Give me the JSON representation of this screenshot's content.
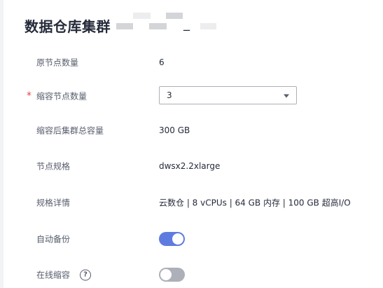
{
  "header": {
    "title": "数据仓库集群",
    "title_suffix": "_"
  },
  "form": {
    "original_nodes": {
      "label": "原节点数量",
      "value": "6"
    },
    "shrink_nodes": {
      "label": "缩容节点数量",
      "required_mark": "*",
      "selected": "3"
    },
    "capacity_after": {
      "label": "缩容后集群总容量",
      "value": "300 GB"
    },
    "node_flavor": {
      "label": "节点规格",
      "value": "dwsx2.2xlarge"
    },
    "flavor_details": {
      "label": "规格详情",
      "value": "云数仓 | 8 vCPUs | 64 GB 内存 | 100 GB 超高I/O"
    },
    "auto_backup": {
      "label": "自动备份",
      "enabled": true
    },
    "online_shrink": {
      "label": "在线缩容",
      "help_glyph": "?",
      "enabled": false
    }
  },
  "colors": {
    "accent": "#5e7ce0",
    "toggle_off": "#adb0b8",
    "required": "#e54545"
  }
}
